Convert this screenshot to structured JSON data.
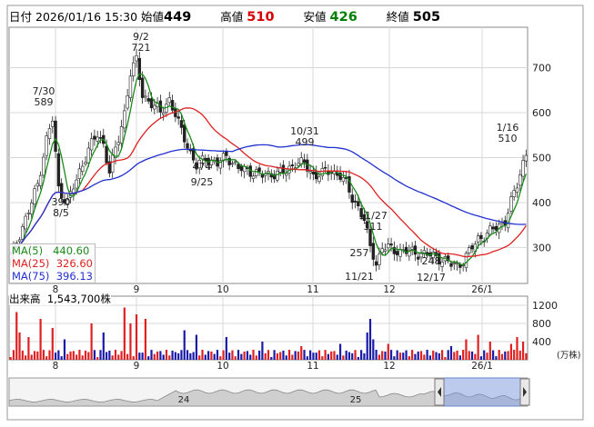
{
  "header": {
    "date_label": "日付",
    "date_value": "2026/01/16 15:30",
    "open_label": "始値",
    "open_value": "449",
    "high_label": "高値",
    "high_value": "510",
    "low_label": "安値",
    "low_value": "426",
    "close_label": "終値",
    "close_value": "505"
  },
  "ma_legend": [
    {
      "label": "MA(5)",
      "value": "440.60",
      "color": "#1a8a1a"
    },
    {
      "label": "MA(25)",
      "value": "326.60",
      "color": "#e02020"
    },
    {
      "label": "MA(75)",
      "value": "396.13",
      "color": "#2030d0"
    }
  ],
  "volume_label": "出来高",
  "volume_value": "1,543,700株",
  "colors": {
    "up": "#e02020",
    "down": "#1a1aa8",
    "ma5": "#1a8a1a",
    "ma25": "#e02020",
    "ma75": "#2030d0",
    "grid": "#d8d8d8"
  },
  "chart_data": {
    "type": "candlestick",
    "x_ticks": [
      "8",
      "9",
      "10",
      "11",
      "12",
      "26/1"
    ],
    "y_ticks": [
      "300",
      "400",
      "500",
      "600",
      "700"
    ],
    "ylim": [
      220,
      790
    ],
    "volume_ticks": [
      "400",
      "800",
      "1200"
    ],
    "volume_unit": "(万株)",
    "volume_ylim": [
      0,
      1400
    ],
    "annotations": [
      {
        "date": "7/30",
        "value": "589"
      },
      {
        "date": "9/2",
        "value": "721"
      },
      {
        "date": "9/25",
        "value": "474"
      },
      {
        "date": "10/31",
        "value": "499"
      },
      {
        "date": "11/27",
        "value": "311"
      },
      {
        "date": "11/21",
        "value": "257"
      },
      {
        "date": "12/17",
        "value": "248"
      },
      {
        "date": "1/16",
        "value": "510"
      },
      {
        "date": "8/5",
        "value": "390"
      }
    ],
    "navigator_labels": [
      "24",
      "25"
    ],
    "anchors": [
      [
        0,
        280
      ],
      [
        3,
        330
      ],
      [
        6,
        380
      ],
      [
        9,
        440
      ],
      [
        12,
        540
      ],
      [
        14,
        585
      ],
      [
        16,
        430
      ],
      [
        19,
        400
      ],
      [
        22,
        450
      ],
      [
        26,
        520
      ],
      [
        29,
        550
      ],
      [
        31,
        530
      ],
      [
        33,
        470
      ],
      [
        36,
        540
      ],
      [
        38,
        600
      ],
      [
        40,
        690
      ],
      [
        42,
        715
      ],
      [
        44,
        640
      ],
      [
        47,
        620
      ],
      [
        50,
        600
      ],
      [
        53,
        630
      ],
      [
        56,
        575
      ],
      [
        58,
        545
      ],
      [
        60,
        510
      ],
      [
        62,
        480
      ],
      [
        65,
        500
      ],
      [
        69,
        485
      ],
      [
        72,
        505
      ],
      [
        76,
        475
      ],
      [
        80,
        470
      ],
      [
        84,
        460
      ],
      [
        88,
        465
      ],
      [
        92,
        468
      ],
      [
        95,
        490
      ],
      [
        98,
        485
      ],
      [
        101,
        460
      ],
      [
        104,
        465
      ],
      [
        107,
        470
      ],
      [
        110,
        460
      ],
      [
        112,
        440
      ],
      [
        114,
        410
      ],
      [
        116,
        390
      ],
      [
        118,
        360
      ],
      [
        119,
        330
      ],
      [
        120,
        300
      ],
      [
        121,
        285
      ],
      [
        122,
        265
      ],
      [
        123,
        280
      ],
      [
        124,
        300
      ],
      [
        126,
        298
      ],
      [
        130,
        292
      ],
      [
        134,
        290
      ],
      [
        138,
        285
      ],
      [
        142,
        280
      ],
      [
        145,
        270
      ],
      [
        147,
        262
      ],
      [
        149,
        260
      ],
      [
        151,
        270
      ],
      [
        153,
        290
      ],
      [
        156,
        320
      ],
      [
        159,
        330
      ],
      [
        162,
        345
      ],
      [
        165,
        360
      ],
      [
        167,
        400
      ],
      [
        169,
        440
      ],
      [
        171,
        490
      ],
      [
        172,
        505
      ]
    ],
    "volume_spikes": [
      [
        2,
        1050
      ],
      [
        3,
        600
      ],
      [
        6,
        500
      ],
      [
        10,
        900
      ],
      [
        14,
        700
      ],
      [
        18,
        450
      ],
      [
        27,
        800
      ],
      [
        31,
        600
      ],
      [
        38,
        1150
      ],
      [
        40,
        800
      ],
      [
        42,
        1000
      ],
      [
        45,
        900
      ],
      [
        58,
        650
      ],
      [
        62,
        550
      ],
      [
        72,
        500
      ],
      [
        84,
        400
      ],
      [
        97,
        300
      ],
      [
        110,
        350
      ],
      [
        119,
        600
      ],
      [
        120,
        900
      ],
      [
        121,
        450
      ],
      [
        126,
        350
      ],
      [
        147,
        300
      ],
      [
        152,
        450
      ],
      [
        156,
        550
      ],
      [
        160,
        400
      ],
      [
        167,
        350
      ],
      [
        169,
        500
      ],
      [
        171,
        400
      ]
    ]
  }
}
